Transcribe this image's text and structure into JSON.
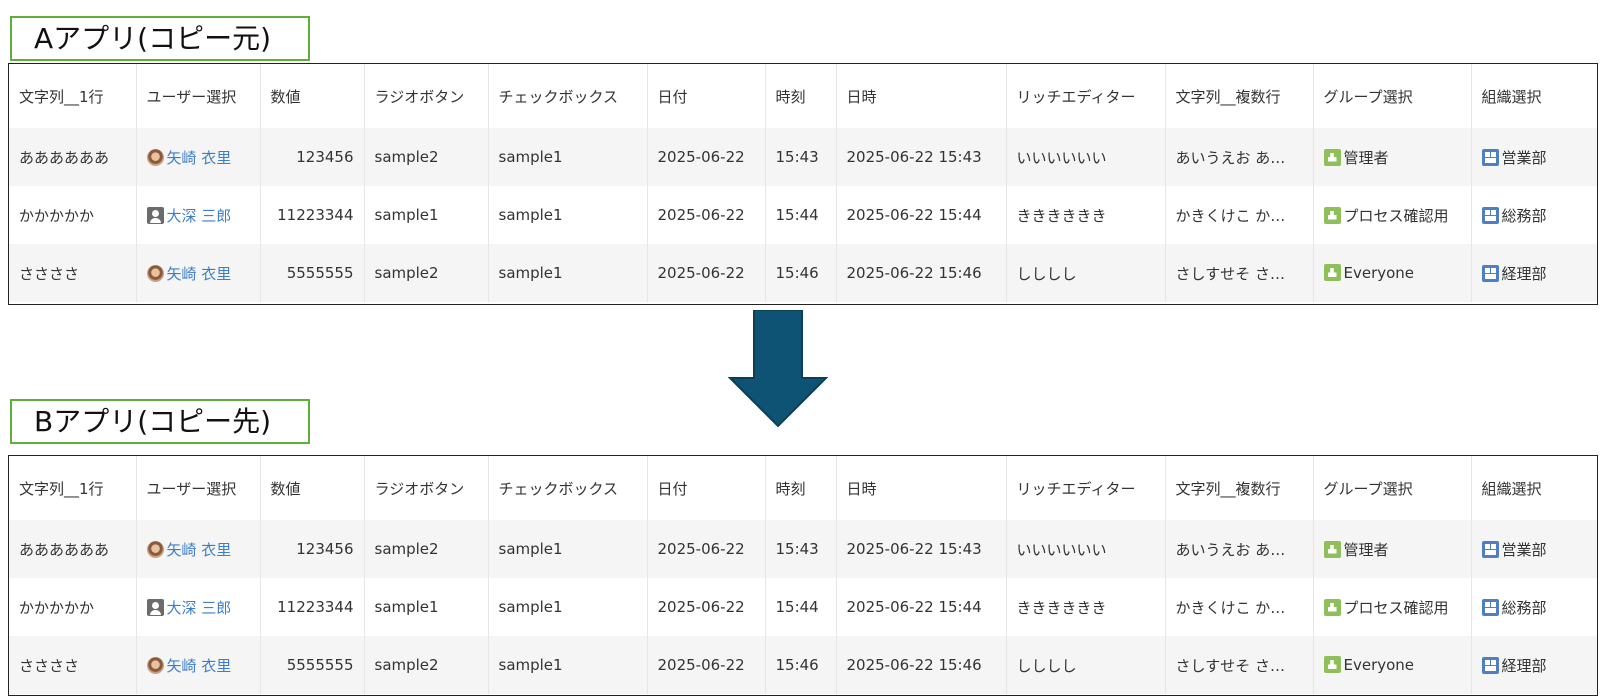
{
  "sections": {
    "a_label": "Aアプリ(コピー元)",
    "b_label": "Bアプリ(コピー先)"
  },
  "colors": {
    "label_border": "#5fae3a",
    "arrow": "#0f5374",
    "user_link": "#3d7ec9"
  },
  "columns": [
    "文字列__1行",
    "ユーザー選択",
    "数値",
    "ラジオボタン",
    "チェックボックス",
    "日付",
    "時刻",
    "日時",
    "リッチエディター",
    "文字列__複数行",
    "グループ選択",
    "組織選択"
  ],
  "rows": [
    {
      "text1": "ああああああ",
      "user": {
        "icon": "user-photo-icon",
        "name": "矢崎 衣里"
      },
      "number": "123456",
      "radio": "sample2",
      "checkbox": "sample1",
      "date": "2025-06-22",
      "time": "15:43",
      "datetime": "2025-06-22 15:43",
      "rich": "いいいいいい",
      "multiline": "あいうえお あ…",
      "group": "管理者",
      "org": "営業部"
    },
    {
      "text1": "かかかかか",
      "user": {
        "icon": "user-default-icon",
        "name": "大深 三郎"
      },
      "number": "11223344",
      "radio": "sample1",
      "checkbox": "sample1",
      "date": "2025-06-22",
      "time": "15:44",
      "datetime": "2025-06-22 15:44",
      "rich": "きききききき",
      "multiline": "かきくけこ か…",
      "group": "プロセス確認用",
      "org": "総務部"
    },
    {
      "text1": "ささささ",
      "user": {
        "icon": "user-photo-icon",
        "name": "矢崎 衣里"
      },
      "number": "5555555",
      "radio": "sample2",
      "checkbox": "sample1",
      "date": "2025-06-22",
      "time": "15:46",
      "datetime": "2025-06-22 15:46",
      "rich": "しししし",
      "multiline": "さしすせそ さ…",
      "group": "Everyone",
      "org": "経理部"
    }
  ]
}
